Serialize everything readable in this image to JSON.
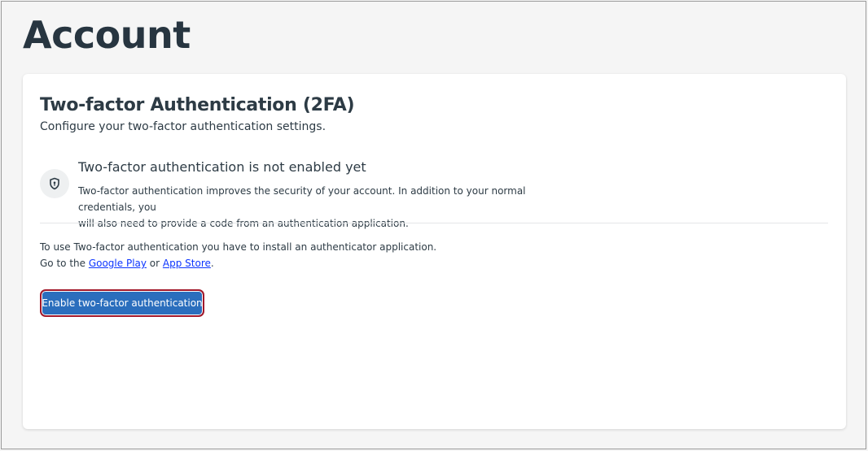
{
  "page": {
    "title": "Account"
  },
  "card": {
    "title": "Two-factor Authentication (2FA)",
    "subtitle": "Configure your two-factor authentication settings."
  },
  "status": {
    "icon": "shield-icon",
    "heading": "Two-factor authentication is not enabled yet",
    "description_line1": "Two-factor authentication improves the security of your account. In addition to your normal credentials, you",
    "description_line2": "will also need to provide a code from an authentication application."
  },
  "instructions": {
    "line1": "To use Two-factor authentication you have to install an authenticator application.",
    "line2_prefix": "Go to the ",
    "google_play_link": "Google Play",
    "connector": " or ",
    "app_store_link": "App Store",
    "line2_suffix": "."
  },
  "actions": {
    "enable_label": "Enable two-factor authentication"
  },
  "colors": {
    "primary_button": "#2b6ebd",
    "button_focus_border": "#a2182a",
    "link": "#0c35ff",
    "text": "#2d3b45"
  }
}
